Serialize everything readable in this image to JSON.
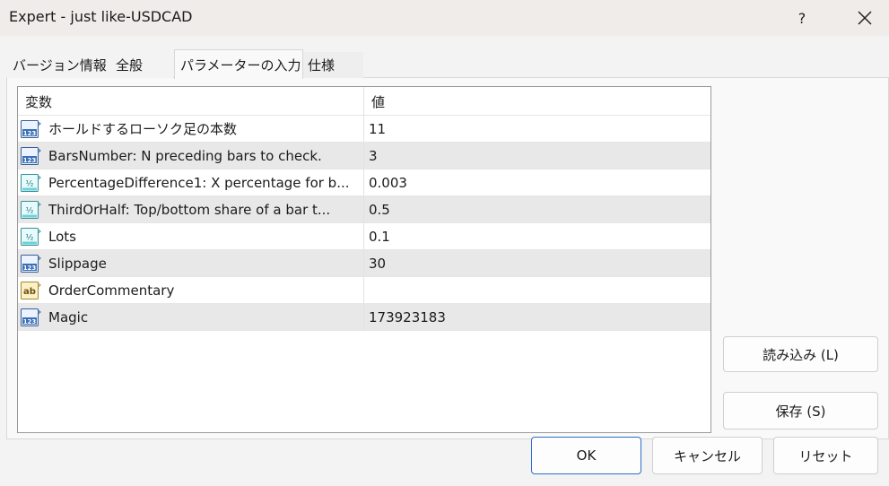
{
  "window": {
    "title": "Expert - just like-USDCAD",
    "help_label": "?"
  },
  "tabs": [
    {
      "label": "バージョン情報"
    },
    {
      "label": "全般"
    },
    {
      "label": "パラメーターの入力"
    },
    {
      "label": "仕様"
    }
  ],
  "grid": {
    "header_variable": "変数",
    "header_value": "値",
    "rows": [
      {
        "icon": "integer-icon",
        "name": "ホールドするローソク足の本数",
        "value": "11"
      },
      {
        "icon": "integer-icon",
        "name": "BarsNumber: N preceding bars to check.",
        "value": "3"
      },
      {
        "icon": "double-icon",
        "name": "PercentageDifference1: X percentage for b...",
        "value": "0.003"
      },
      {
        "icon": "double-icon",
        "name": "ThirdOrHalf: Top/bottom share of a bar t...",
        "value": "0.5"
      },
      {
        "icon": "double-icon",
        "name": "Lots",
        "value": "0.1"
      },
      {
        "icon": "integer-icon",
        "name": "Slippage",
        "value": "30"
      },
      {
        "icon": "string-icon",
        "name": "OrderCommentary",
        "value": ""
      },
      {
        "icon": "integer-icon",
        "name": "Magic",
        "value": "173923183"
      }
    ]
  },
  "buttons": {
    "load": "読み込み (L)",
    "save": "保存 (S)",
    "ok": "OK",
    "cancel": "キャンセル",
    "reset": "リセット"
  },
  "colors": {
    "primary_border": "#2a6fc9",
    "alt_row": "#e8e8e8"
  }
}
